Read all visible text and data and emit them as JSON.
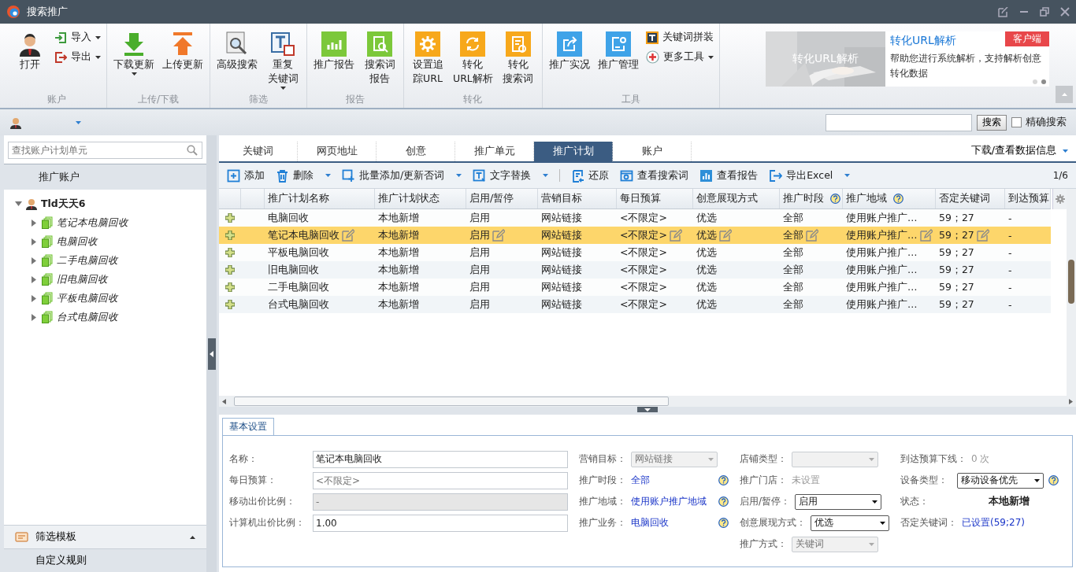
{
  "title": "搜索推广",
  "ribbon": {
    "groups": [
      {
        "label": "账户",
        "buttons": [
          {
            "label": "打开",
            "kind": "large",
            "dropdown": false
          },
          {
            "label": "导入",
            "kind": "small",
            "dropdown": true
          },
          {
            "label": "导出",
            "kind": "small",
            "dropdown": true
          }
        ]
      },
      {
        "label": "上传/下载",
        "buttons": [
          {
            "label": "下载更新",
            "kind": "large",
            "dropdown": true
          },
          {
            "label": "上传更新",
            "kind": "large",
            "dropdown": false
          }
        ]
      },
      {
        "label": "筛选",
        "buttons": [
          {
            "label": "高级搜索",
            "kind": "large",
            "dropdown": false
          },
          {
            "lines": [
              "重复",
              "关键词"
            ],
            "kind": "large",
            "dropdown": true
          }
        ]
      },
      {
        "label": "报告",
        "buttons": [
          {
            "label": "推广报告",
            "kind": "large",
            "dropdown": false
          },
          {
            "lines": [
              "搜索词",
              "报告"
            ],
            "kind": "large",
            "dropdown": false
          }
        ]
      },
      {
        "label": "转化",
        "buttons": [
          {
            "lines": [
              "设置追",
              "踪URL"
            ],
            "kind": "large",
            "dropdown": false
          },
          {
            "lines": [
              "转化",
              "URL解析"
            ],
            "kind": "large",
            "dropdown": false
          },
          {
            "lines": [
              "转化",
              "搜索词"
            ],
            "kind": "large",
            "dropdown": false
          }
        ]
      },
      {
        "label": "工具",
        "buttons": [
          {
            "label": "推广实况",
            "kind": "large",
            "dropdown": false
          },
          {
            "label": "推广管理",
            "kind": "large",
            "dropdown": false
          },
          {
            "label": "关键词拼装",
            "kind": "small",
            "dropdown": false
          },
          {
            "label": "更多工具",
            "kind": "small",
            "dropdown": true
          }
        ]
      }
    ],
    "banner": {
      "caption": "转化URL解析",
      "title": "转化URL解析",
      "badge": "客户端",
      "description": "帮助您进行系统解析，支持解析创意转化数据",
      "slides": [
        {
          "selected": false
        },
        {
          "selected": true
        }
      ]
    }
  },
  "search": {
    "button": "搜索",
    "exact": {
      "label": "精确搜索",
      "checked": false
    }
  },
  "sidebar": {
    "placeholder": "查找账户计划单元",
    "header": "推广账户",
    "tree": [
      {
        "label": "Tld天天6",
        "expanded": true,
        "children": [
          {
            "label": "笔记本电脑回收",
            "expanded": false
          },
          {
            "label": "电脑回收",
            "expanded": false
          },
          {
            "label": "二手电脑回收",
            "expanded": false
          },
          {
            "label": "旧电脑回收",
            "expanded": false
          },
          {
            "label": "平板电脑回收",
            "expanded": false
          },
          {
            "label": "台式电脑回收",
            "expanded": false
          }
        ]
      }
    ],
    "bottom": [
      {
        "label": "筛选模板",
        "expanded": false
      },
      {
        "label": "自定义规则"
      }
    ]
  },
  "tabs": [
    {
      "label": "关键词",
      "selected": false
    },
    {
      "label": "网页地址",
      "selected": false
    },
    {
      "label": "创意",
      "selected": false
    },
    {
      "label": "推广单元",
      "selected": false
    },
    {
      "label": "推广计划",
      "selected": true
    },
    {
      "label": "账户",
      "selected": false
    }
  ],
  "data_menu": "下载/查看数据信息",
  "toolbar": {
    "actions": [
      {
        "label": "添加",
        "dropdown": false
      },
      {
        "label": "删除",
        "dropdown": true
      },
      {
        "label": "批量添加/更新否词",
        "dropdown": true
      },
      {
        "label": "文字替换",
        "dropdown": true
      },
      {
        "label": "还原",
        "dropdown": false
      },
      {
        "label": "查看搜索词",
        "dropdown": false
      },
      {
        "label": "查看报告",
        "dropdown": false
      },
      {
        "label": "导出Excel",
        "dropdown": true
      }
    ],
    "pager": "1/6"
  },
  "table": {
    "columns": [
      {
        "label": "推广计划名称",
        "help": false,
        "editable": true
      },
      {
        "label": "推广计划状态",
        "help": false,
        "editable": false
      },
      {
        "label": "启用/暂停",
        "help": false,
        "editable": true
      },
      {
        "label": "营销目标",
        "help": false,
        "editable": false
      },
      {
        "label": "每日预算",
        "help": false,
        "editable": true
      },
      {
        "label": "创意展现方式",
        "help": false,
        "editable": true
      },
      {
        "label": "推广时段",
        "help": true,
        "editable": true
      },
      {
        "label": "推广地域",
        "help": true,
        "editable": true
      },
      {
        "label": "否定关键词",
        "help": false,
        "editable": true
      },
      {
        "label": "到达预算",
        "help": false,
        "editable": false
      }
    ],
    "rows": [
      {
        "selected": false,
        "cells": [
          "电脑回收",
          "本地新增",
          "启用",
          "网站链接",
          "<不限定>",
          "优选",
          "全部",
          "使用账户推广…",
          "59；27",
          "-"
        ]
      },
      {
        "selected": true,
        "cells": [
          "笔记本电脑回收",
          "本地新增",
          "启用",
          "网站链接",
          "<不限定>",
          "优选",
          "全部",
          "使用账户推广…",
          "59；27",
          "-"
        ]
      },
      {
        "selected": false,
        "cells": [
          "平板电脑回收",
          "本地新增",
          "启用",
          "网站链接",
          "<不限定>",
          "优选",
          "全部",
          "使用账户推广…",
          "59；27",
          "-"
        ]
      },
      {
        "selected": false,
        "cells": [
          "旧电脑回收",
          "本地新增",
          "启用",
          "网站链接",
          "<不限定>",
          "优选",
          "全部",
          "使用账户推广…",
          "59；27",
          "-"
        ]
      },
      {
        "selected": false,
        "cells": [
          "二手电脑回收",
          "本地新增",
          "启用",
          "网站链接",
          "<不限定>",
          "优选",
          "全部",
          "使用账户推广…",
          "59；27",
          "-"
        ]
      },
      {
        "selected": false,
        "cells": [
          "台式电脑回收",
          "本地新增",
          "启用",
          "网站链接",
          "<不限定>",
          "优选",
          "全部",
          "使用账户推广…",
          "59；27",
          "-"
        ]
      }
    ]
  },
  "details": {
    "tab": "基本设置",
    "columns": [
      [
        {
          "label": "名称：",
          "kind": "input",
          "value": "笔记本电脑回收",
          "disabled": false,
          "help": false
        },
        {
          "label": "每日预算：",
          "kind": "input",
          "placeholder": "<不限定>",
          "disabled": false,
          "help": false
        },
        {
          "label": "移动出价比例：",
          "kind": "input",
          "value": "-",
          "disabled": true,
          "help": false
        },
        {
          "label": "计算机出价比例：",
          "kind": "input",
          "value": "1.00",
          "disabled": false,
          "help": false
        }
      ],
      [
        {
          "label": "营销目标：",
          "kind": "select",
          "value": "网站链接",
          "disabled": true,
          "help": false
        },
        {
          "label": "推广时段：",
          "kind": "link",
          "value": "全部",
          "help": true
        },
        {
          "label": "推广地域：",
          "kind": "link",
          "value": "使用账户推广地域",
          "help": true
        },
        {
          "label": "推广业务：",
          "kind": "link",
          "value": "电脑回收",
          "help": true
        }
      ],
      [
        {
          "label": "店铺类型：",
          "kind": "select",
          "disabled": true,
          "help": false
        },
        {
          "label": "推广门店：",
          "kind": "text",
          "value": "未设置",
          "disabled": true,
          "help": false
        },
        {
          "label": "启用/暂停：",
          "kind": "select",
          "value": "启用",
          "disabled": false,
          "help": false
        },
        {
          "label": "创意展现方式：",
          "kind": "select",
          "value": "优选",
          "disabled": false,
          "help": false
        },
        {
          "label": "推广方式：",
          "kind": "select",
          "value": "关键词",
          "disabled": true,
          "help": false
        }
      ],
      [
        {
          "label": "到达预算下线：",
          "kind": "text",
          "value": "0 次",
          "disabled": true,
          "help": false
        },
        {
          "label": "设备类型：",
          "kind": "select",
          "value": "移动设备优先",
          "disabled": false,
          "help": true
        },
        {
          "label": "状态：",
          "kind": "strong",
          "value": "本地新增",
          "help": false
        },
        {
          "label": "否定关键词：",
          "kind": "link",
          "value": "已设置(59;27)",
          "help": false
        }
      ]
    ]
  }
}
